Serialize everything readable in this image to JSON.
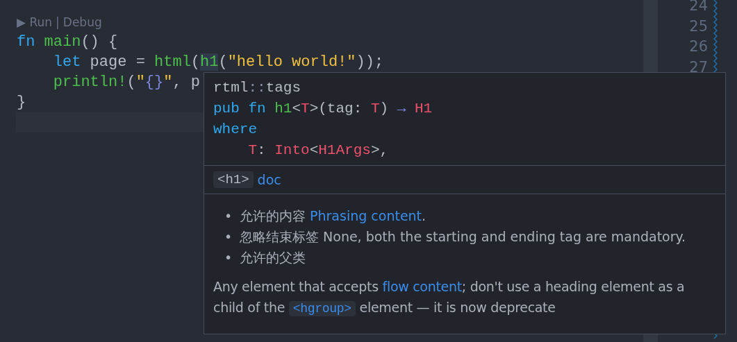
{
  "codelens": [
    {
      "label": "▶ Run"
    },
    {
      "label": "|"
    },
    {
      "label": "Debug"
    }
  ],
  "code_lines": [
    {
      "tokens": [
        {
          "kind": "keyword",
          "text": "fn"
        },
        {
          "kind": "function",
          "text": " main"
        },
        {
          "kind": "plain",
          "text": "() {"
        }
      ]
    },
    {
      "tokens": [
        {
          "kind": "keyword",
          "text": "    let"
        },
        {
          "kind": "plain",
          "text": " page = "
        },
        {
          "kind": "function",
          "text": "html"
        },
        {
          "kind": "plain",
          "text": "("
        },
        {
          "kind": "function",
          "text": "h1",
          "highlight": true
        },
        {
          "kind": "plain",
          "text": "("
        },
        {
          "kind": "string",
          "text": "\"hello world!\""
        },
        {
          "kind": "plain",
          "text": "));"
        }
      ]
    },
    {
      "tokens": [
        {
          "kind": "function",
          "text": "    println!"
        },
        {
          "kind": "plain",
          "text": "("
        },
        {
          "kind": "string",
          "text": "\""
        },
        {
          "kind": "format",
          "text": "{}"
        },
        {
          "kind": "string",
          "text": "\""
        },
        {
          "kind": "plain",
          "text": ", p"
        }
      ]
    },
    {
      "tokens": [
        {
          "kind": "plain",
          "text": "}"
        }
      ]
    }
  ],
  "current_line_highlight": true,
  "side_line_numbers": [
    "24",
    "25",
    "26",
    "27"
  ],
  "hover": {
    "path": [
      {
        "kind": "plain",
        "text": "rtml"
      },
      {
        "kind": "punct",
        "text": "::"
      },
      {
        "kind": "plain",
        "text": "tags"
      }
    ],
    "signature": [
      [
        {
          "kind": "keyword",
          "text": "pub fn "
        },
        {
          "kind": "function",
          "text": "h1"
        },
        {
          "kind": "plain",
          "text": "<"
        },
        {
          "kind": "type",
          "text": "T"
        },
        {
          "kind": "plain",
          "text": ">(tag: "
        },
        {
          "kind": "type",
          "text": "T"
        },
        {
          "kind": "plain",
          "text": ") "
        },
        {
          "kind": "arrow",
          "text": "→"
        },
        {
          "kind": "type",
          "text": " H1"
        }
      ],
      [
        {
          "kind": "keyword",
          "text": "where"
        }
      ],
      [
        {
          "kind": "type",
          "text": "    T"
        },
        {
          "kind": "plain",
          "text": ": "
        },
        {
          "kind": "type",
          "text": "Into"
        },
        {
          "kind": "plain",
          "text": "<"
        },
        {
          "kind": "type",
          "text": "H1Args"
        },
        {
          "kind": "plain",
          "text": ">,"
        }
      ]
    ],
    "doc_header": {
      "code": "<h1>",
      "link": "doc"
    },
    "bullets": [
      {
        "marker": "•",
        "segments": [
          {
            "kind": "text",
            "text": "允许的内容 "
          },
          {
            "kind": "link",
            "text": "Phrasing content"
          },
          {
            "kind": "text",
            "text": "."
          }
        ]
      },
      {
        "marker": "•",
        "segments": [
          {
            "kind": "text",
            "text": "忽略结束标签 None, both the starting and ending tag are mandatory."
          }
        ]
      },
      {
        "marker": "•",
        "segments": [
          {
            "kind": "text",
            "text": "允许的父类"
          }
        ]
      }
    ],
    "paragraph": [
      {
        "kind": "text",
        "text": "Any element that accepts "
      },
      {
        "kind": "link",
        "text": "flow content"
      },
      {
        "kind": "text",
        "text": "; don't use a heading element as a child of the "
      },
      {
        "kind": "code",
        "text": "<hgroup>"
      },
      {
        "kind": "text",
        "text": " element — it is now deprecate"
      }
    ]
  }
}
